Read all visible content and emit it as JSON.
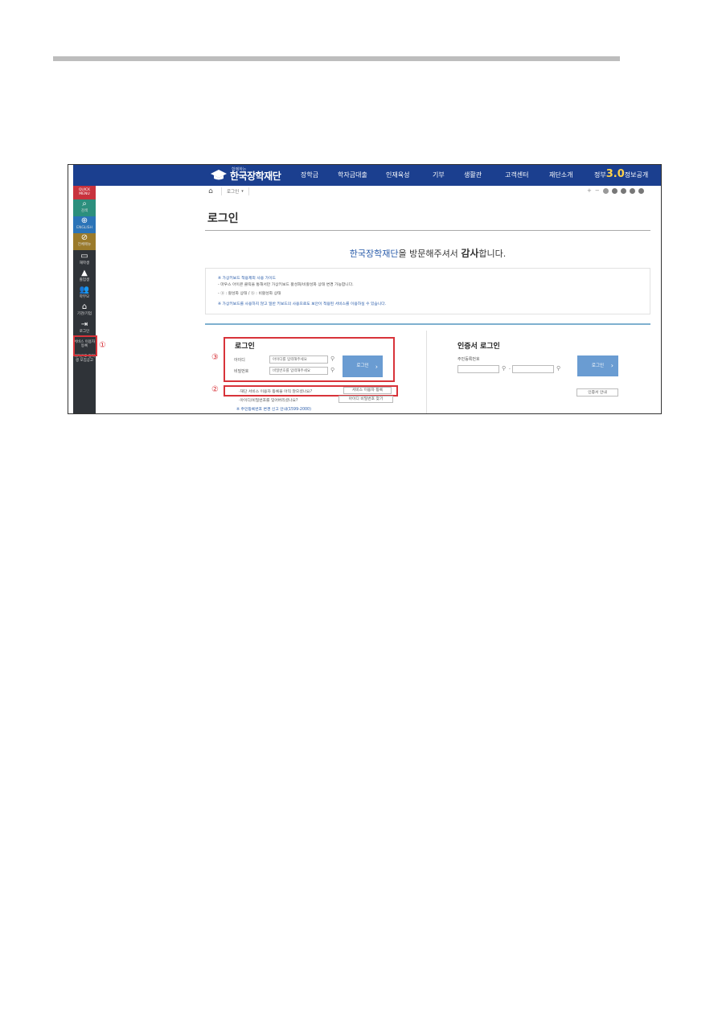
{
  "header": {
    "logo_sub": "함께하는",
    "logo_main": "한국장학재단",
    "menu": [
      "장학금",
      "학자금대출",
      "인재육성",
      "기부",
      "생활관",
      "고객센터",
      "재단소개"
    ],
    "gov_prefix": "정부",
    "gov_num": "3.0",
    "gov_suffix": "정보공개"
  },
  "sidebar": {
    "items": [
      {
        "icon": "",
        "label": "QUICK MENU"
      },
      {
        "icon": "⌕",
        "label": "검색"
      },
      {
        "icon": "⊕",
        "label": "ENGLISH"
      },
      {
        "icon": "⊘",
        "label": "전체메뉴"
      },
      {
        "icon": "▭",
        "label": "재학생"
      },
      {
        "icon": "▲",
        "label": "졸업생"
      },
      {
        "icon": "👥",
        "label": "학부모"
      },
      {
        "icon": "⌂",
        "label": "기관/기업"
      },
      {
        "icon": "⇥",
        "label": "로그인"
      },
      {
        "icon": "",
        "label": "서비스 이용자 등록"
      },
      {
        "icon": "",
        "label": "국가근로 장학생 모집공고"
      }
    ]
  },
  "breadcrumb": {
    "current": "로그인"
  },
  "tools": {
    "plus": "+",
    "minus": "−"
  },
  "page": {
    "title": "로그인",
    "welcome_org": "한국장학재단",
    "welcome_mid": "을 방문해주셔서 ",
    "welcome_bold": "감사",
    "welcome_end": "합니다."
  },
  "guide": {
    "line1": "※ 가상키보드 적용제외 사용 가이드",
    "line2": "- 마우스 아이콘 클릭을 통해서만 가상키보드 활성화/비활성화 상태 변경 가능합니다.",
    "line3": "- ⓐ : 활성화 상태 / ⓑ : 비활성화 상태",
    "line4": "※ 가상키보드를 사용하지 않고 일반 키보드의 사용으로도 보안이 적용된 서비스를 이용하실 수 있습니다."
  },
  "login": {
    "title": "로그인",
    "id_label": "아이디",
    "id_placeholder": "아이디를 입력해주세요",
    "pw_label": "비밀번호",
    "pw_placeholder": "비밀번호를 입력해주세요",
    "button": "로그인",
    "link1_text": "·재단 서비스 이용자 등록을 아직 않으셨나요?",
    "link1_btn": "서비스 이용자 등록",
    "link2_text": "·아이디/비밀번호를 잊어버리셨나요?",
    "link2_btn": "아이디 비밀번호 찾기",
    "footnote": "※ 주민등록번호 변경 신고 안내(1599-2000)"
  },
  "cert": {
    "title": "인증서 로그인",
    "label": "주민등록번호",
    "button": "로그인",
    "guide_btn": "인증서 안내"
  },
  "annotations": {
    "step1": "①",
    "step2": "②",
    "step3": "③"
  }
}
